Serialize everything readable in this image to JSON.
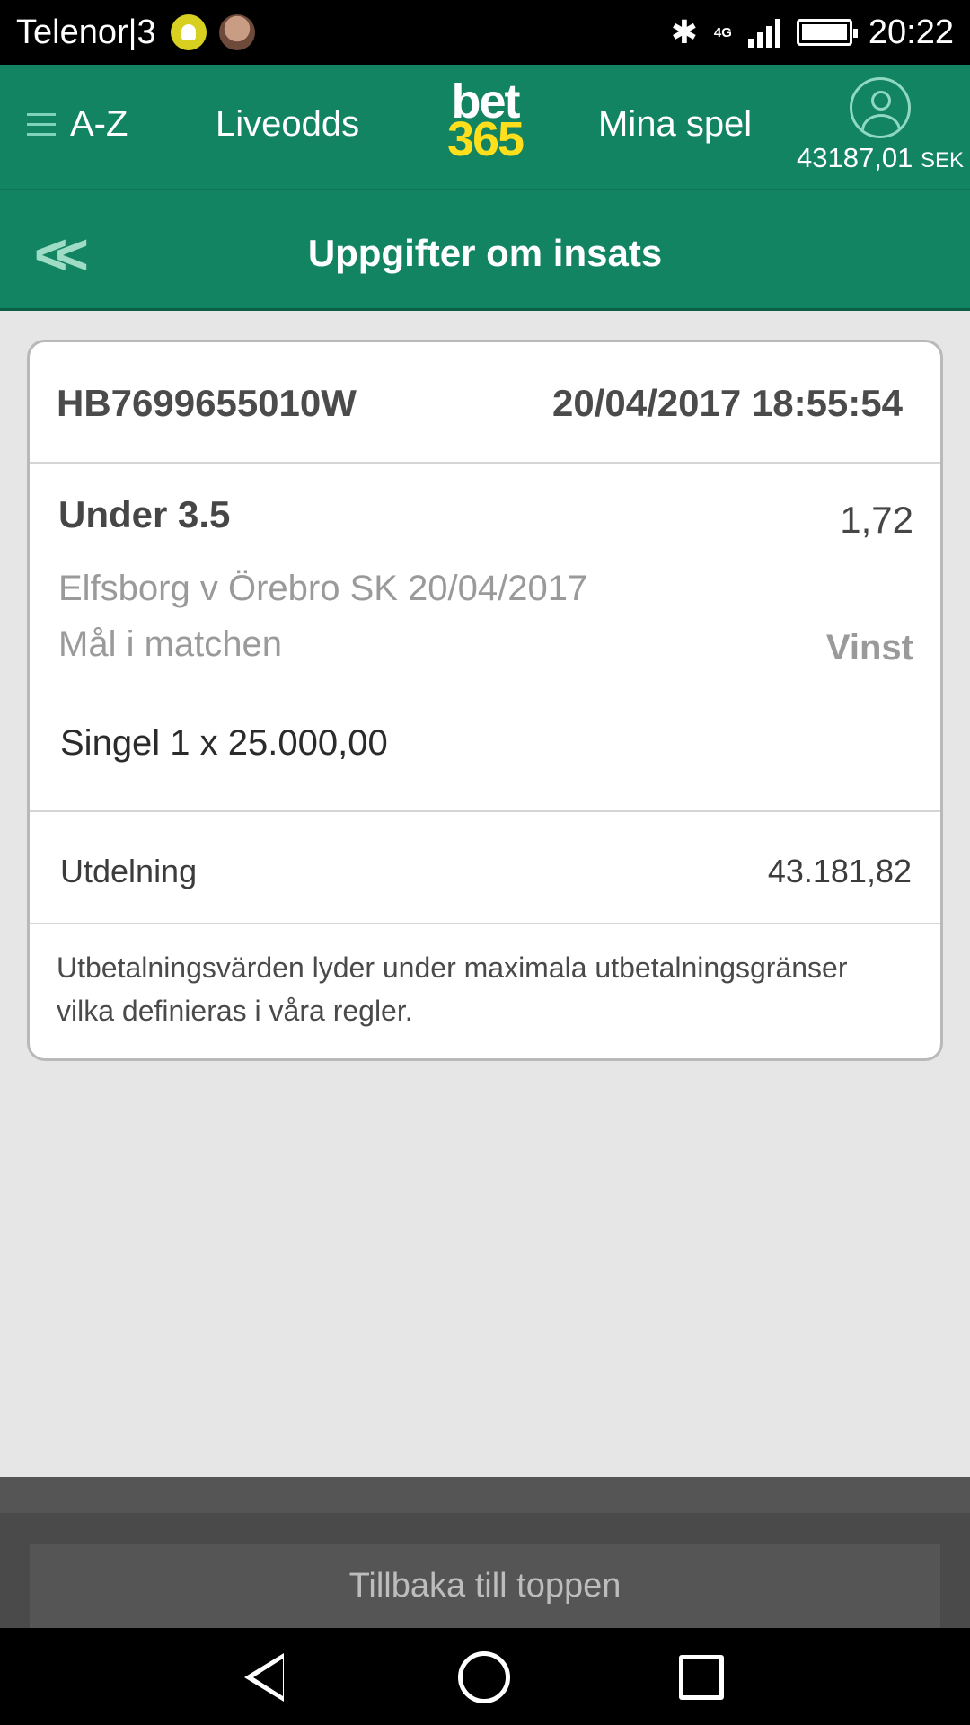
{
  "status_bar": {
    "carrier": "Telenor|3",
    "network": "4G",
    "time": "20:22"
  },
  "header": {
    "menu_label": "A-Z",
    "liveodds_label": "Liveodds",
    "logo_top": "bet",
    "logo_bottom": "365",
    "my_bets_label": "Mina spel",
    "balance": "43187,01",
    "currency": "SEK",
    "brand_color": "#138462",
    "logo_accent": "#ffdf1b"
  },
  "subheader": {
    "title": "Uppgifter om insats"
  },
  "bet": {
    "reference": "HB7699655010W",
    "datetime": "20/04/2017 18:55:54",
    "selection": "Under 3.5",
    "odds": "1,72",
    "event": "Elfsborg v Örebro SK 20/04/2017",
    "market": "Mål i matchen",
    "result": "Vinst",
    "stake": "Singel 1 x 25.000,00",
    "payout_label": "Utdelning",
    "payout_value": "43.181,82",
    "disclaimer": "Utbetalningsvärden lyder under maximala utbetalningsgränser vilka definieras i våra regler."
  },
  "footer": {
    "back_to_top": "Tillbaka till toppen"
  }
}
